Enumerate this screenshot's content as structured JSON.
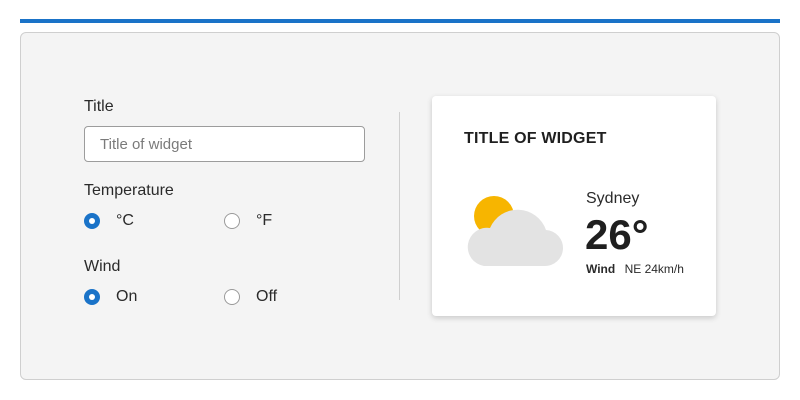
{
  "form": {
    "title_label": "Title",
    "title_placeholder": "Title of widget",
    "title_value": "",
    "temperature_label": "Temperature",
    "temperature_options": [
      {
        "label": "°C",
        "checked": true
      },
      {
        "label": "°F",
        "checked": false
      }
    ],
    "wind_label": "Wind",
    "wind_options": [
      {
        "label": "On",
        "checked": true
      },
      {
        "label": "Off",
        "checked": false
      }
    ]
  },
  "widget": {
    "title": "TITLE OF WIDGET",
    "city": "Sydney",
    "temperature": "26°",
    "wind_label": "Wind",
    "wind_value": "NE 24km/h",
    "icon": "partly-cloudy-icon"
  },
  "colors": {
    "accent": "#1a73c8",
    "sun": "#f7b500",
    "cloud": "#e3e3e3"
  }
}
